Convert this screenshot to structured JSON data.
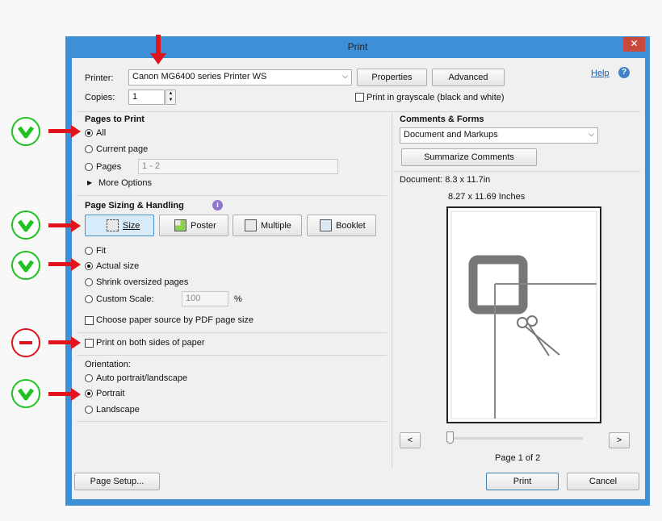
{
  "window": {
    "title": "Print",
    "close_glyph": "✕"
  },
  "printer": {
    "label": "Printer:",
    "value": "Canon MG6400 series Printer WS",
    "properties_label": "Properties",
    "advanced_label": "Advanced",
    "help_label": "Help",
    "copies_label": "Copies:",
    "copies_value": "1",
    "grayscale_label": "Print in grayscale (black and white)"
  },
  "pages_to_print": {
    "title": "Pages to Print",
    "all_label": "All",
    "current_label": "Current page",
    "pages_label": "Pages",
    "pages_value": "1 - 2",
    "more_options_label": "More Options"
  },
  "sizing": {
    "title": "Page Sizing & Handling",
    "buttons": [
      "Size",
      "Poster",
      "Multiple",
      "Booklet"
    ],
    "fit_label": "Fit",
    "actual_label": "Actual size",
    "shrink_label": "Shrink oversized pages",
    "custom_label": "Custom Scale:",
    "custom_value": "100",
    "percent": "%",
    "paper_source_label": "Choose paper source by PDF page size"
  },
  "duplex": {
    "label": "Print on both sides of paper"
  },
  "orientation": {
    "title": "Orientation:",
    "auto_label": "Auto portrait/landscape",
    "portrait_label": "Portrait",
    "landscape_label": "Landscape"
  },
  "comments": {
    "title": "Comments & Forms",
    "value": "Document and Markups",
    "summarize_label": "Summarize Comments"
  },
  "preview": {
    "document_size": "Document: 8.3 x 11.7in",
    "paper_size": "8.27 x 11.69 Inches",
    "prev_label": "<",
    "next_label": ">",
    "page_indicator": "Page 1 of 2",
    "slider_position": 0
  },
  "footer": {
    "page_setup_label": "Page Setup...",
    "print_label": "Print",
    "cancel_label": "Cancel"
  },
  "annotations": {
    "check_color": "#1fc21f",
    "minus_color": "#e0141c",
    "arrow_color": "#e0141c"
  }
}
